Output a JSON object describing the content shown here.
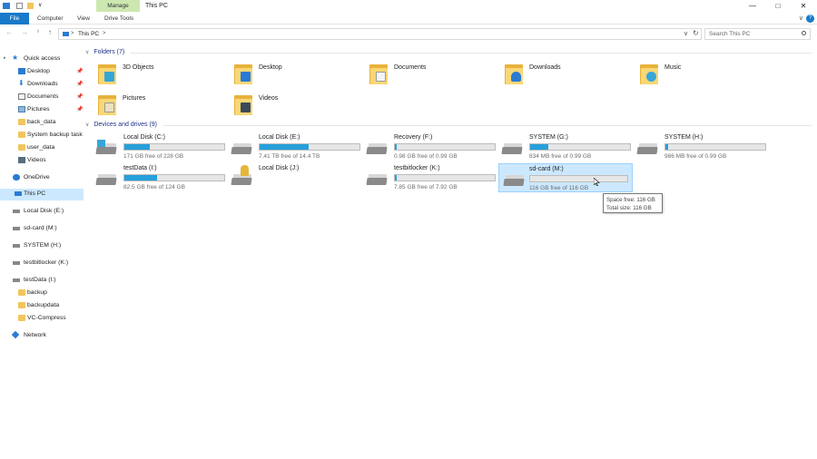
{
  "titlebar": {
    "title": "This PC",
    "manage_tab": "Manage",
    "quick_access_chevron": "∨",
    "buttons": {
      "minimize": "—",
      "maximize": "□",
      "close": "✕"
    }
  },
  "ribbon": {
    "tabs": [
      "File",
      "Computer",
      "View",
      "Drive Tools"
    ],
    "help": "?",
    "collapse": "∨"
  },
  "address": {
    "path": "This PC",
    "separator": ">",
    "search_placeholder": "Search This PC"
  },
  "nav": {
    "quick_access": "Quick access",
    "quick_items": [
      {
        "label": "Desktop",
        "pinned": true
      },
      {
        "label": "Downloads",
        "pinned": true
      },
      {
        "label": "Documents",
        "pinned": true
      },
      {
        "label": "Pictures",
        "pinned": true
      },
      {
        "label": "back_data",
        "pinned": false
      },
      {
        "label": "System backup task",
        "pinned": false
      },
      {
        "label": "user_data",
        "pinned": false
      },
      {
        "label": "Videos",
        "pinned": false
      }
    ],
    "onedrive": "OneDrive",
    "this_pc": "This PC",
    "drives": [
      "Local Disk (E:)",
      "sd-card (M:)",
      "SYSTEM (H:)",
      "testbitlocker (K:)",
      "testData (I:)"
    ],
    "testdata_children": [
      "backup",
      "backupdata",
      "VC-Compress"
    ],
    "network": "Network"
  },
  "folders": {
    "header": "Folders (7)",
    "items": [
      {
        "label": "3D Objects",
        "icon": "3d-objects-icon"
      },
      {
        "label": "Desktop",
        "icon": "desktop-icon"
      },
      {
        "label": "Documents",
        "icon": "documents-icon"
      },
      {
        "label": "Downloads",
        "icon": "downloads-icon"
      },
      {
        "label": "Music",
        "icon": "music-icon"
      },
      {
        "label": "Pictures",
        "icon": "pictures-icon"
      },
      {
        "label": "Videos",
        "icon": "videos-icon"
      }
    ]
  },
  "drives": {
    "header": "Devices and drives (9)",
    "items": [
      {
        "name": "Local Disk (C:)",
        "free": "171 GB free of 228 GB",
        "used_fraction": 0.25,
        "icon": "windows-drive-icon"
      },
      {
        "name": "Local Disk (E:)",
        "free": "7.41 TB free of 14.4 TB",
        "used_fraction": 0.49,
        "icon": "drive-icon"
      },
      {
        "name": "Recovery (F:)",
        "free": "0.98 GB free of 0.99 GB",
        "used_fraction": 0.01,
        "icon": "drive-icon"
      },
      {
        "name": "SYSTEM (G:)",
        "free": "834 MB free of 0.99 GB",
        "used_fraction": 0.18,
        "icon": "drive-icon"
      },
      {
        "name": "SYSTEM (H:)",
        "free": "986 MB free of 0.99 GB",
        "used_fraction": 0.03,
        "icon": "drive-icon"
      },
      {
        "name": "testData (I:)",
        "free": "82.5 GB free of 124 GB",
        "used_fraction": 0.33,
        "icon": "drive-icon"
      },
      {
        "name": "Local Disk (J:)",
        "free": "",
        "used_fraction": null,
        "icon": "locked-drive-icon"
      },
      {
        "name": "testbitlocker (K:)",
        "free": "7.85 GB free of 7.92 GB",
        "used_fraction": 0.01,
        "icon": "drive-icon"
      },
      {
        "name": "sd-card (M:)",
        "free": "116 GB free of 116 GB",
        "used_fraction": 0.0,
        "icon": "drive-icon",
        "selected": true
      }
    ]
  },
  "tooltip": {
    "line1": "Space free: 116 GB",
    "line2": "Total size: 116 GB"
  },
  "colors": {
    "accent": "#1979ca",
    "bar_fill": "#26a0da",
    "selection": "#cce8ff",
    "manage_tab": "#cde7b0",
    "header_text": "#1e3287"
  }
}
